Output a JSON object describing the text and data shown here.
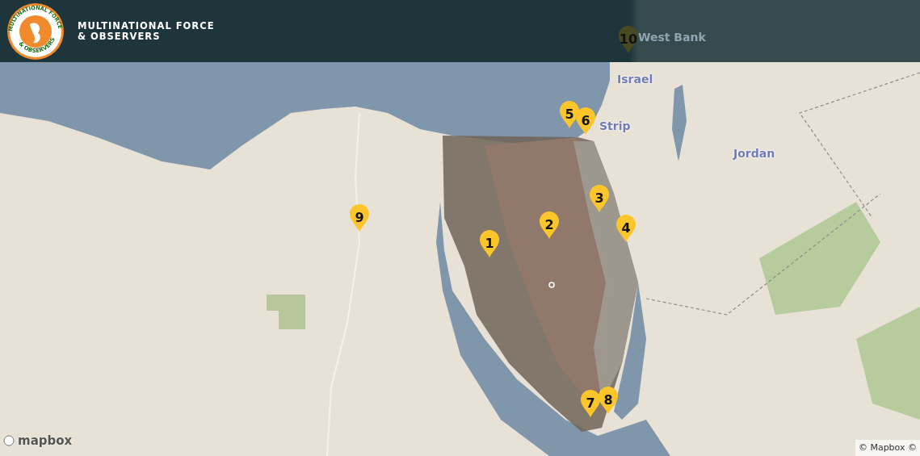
{
  "header": {
    "logo_ring_top": "MULTINATIONAL FORCE",
    "logo_ring_bottom": "& OBSERVERS",
    "title_line_1": "MULTINATIONAL FORCE",
    "title_line_2": "& OBSERVERS"
  },
  "map": {
    "labels": [
      {
        "text": "West Bank",
        "kind": "dim"
      },
      {
        "text": "Israel",
        "kind": "region"
      },
      {
        "text": "Strip",
        "kind": "region"
      },
      {
        "text": "Jordan",
        "kind": "region"
      }
    ],
    "markers": [
      {
        "label": "1"
      },
      {
        "label": "2"
      },
      {
        "label": "3"
      },
      {
        "label": "4"
      },
      {
        "label": "5"
      },
      {
        "label": "6"
      },
      {
        "label": "7"
      },
      {
        "label": "8"
      },
      {
        "label": "9"
      },
      {
        "label": "10"
      }
    ],
    "logo": "mapbox",
    "attribution": "© Mapbox ©"
  }
}
